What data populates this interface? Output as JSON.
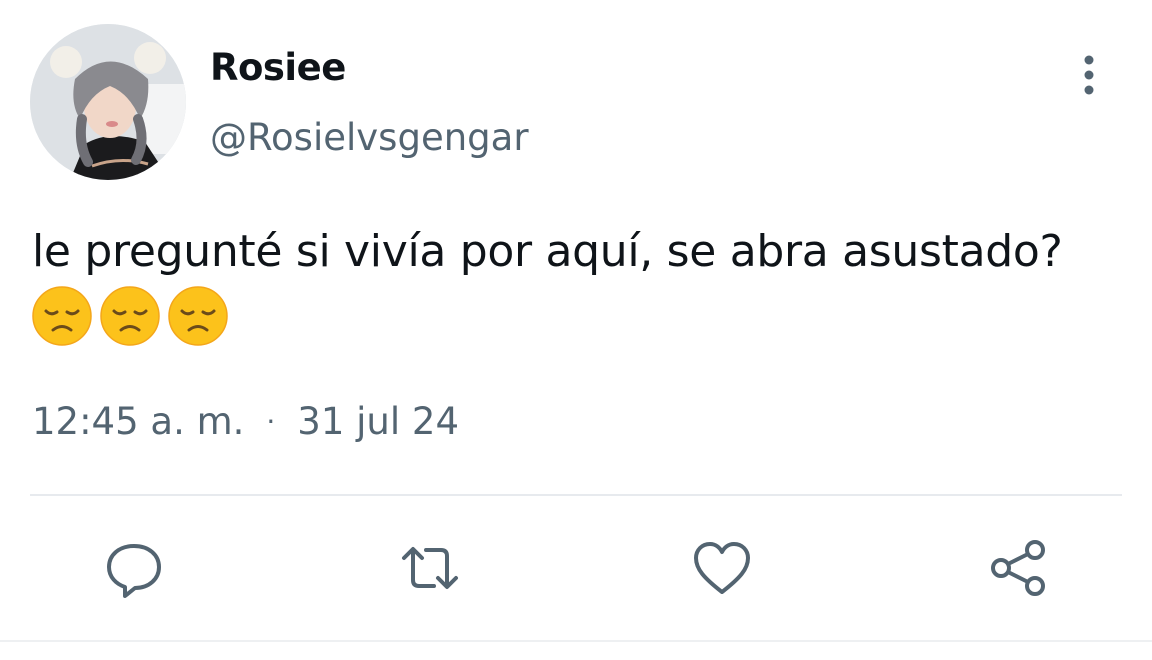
{
  "author": {
    "display_name": "Rosiee",
    "handle": "@Rosielvsgengar"
  },
  "tweet": {
    "text": "le pregunté si vivía por aquí, se abra asustado?",
    "emojis": [
      "😞",
      "😞",
      "😞"
    ]
  },
  "meta": {
    "time": "12:45 a. m.",
    "separator": "·",
    "date": "31 jul 24"
  },
  "icons": {
    "more": "more-vertical-icon",
    "reply": "reply-icon",
    "retweet": "retweet-icon",
    "like": "heart-icon",
    "share": "share-icon"
  },
  "colors": {
    "text": "#0f1419",
    "secondary": "#536471",
    "divider": "#e7eaee"
  }
}
